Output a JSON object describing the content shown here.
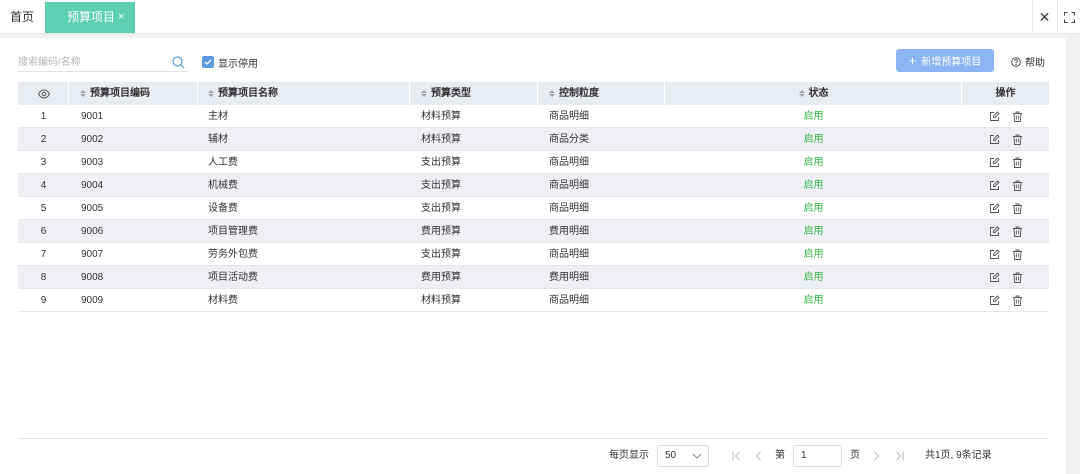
{
  "tabs": {
    "home": "首页",
    "active": "预算项目",
    "active_close": "×"
  },
  "window": {
    "close": "✕"
  },
  "toolbar": {
    "search_placeholder": "搜索编码/名称",
    "search_value": "",
    "show_disabled_label": "显示停用",
    "show_disabled_checked": true,
    "add_button": "新增预算项目",
    "add_icon": "+",
    "help_label": "帮助"
  },
  "colors": {
    "accent_tab": "#5fcfb1",
    "primary_button": "#8ab4f2",
    "status_enabled": "#39b54a",
    "header_bg": "#e8ebf2"
  },
  "table": {
    "columns": {
      "code": "预算项目编码",
      "name": "预算项目名称",
      "type": "预算类型",
      "granularity": "控制粒度",
      "status": "状态",
      "actions": "操作"
    },
    "rows": [
      {
        "idx": "1",
        "code": "9001",
        "name": "主材",
        "type": "材料预算",
        "granularity": "商品明细",
        "status": "启用"
      },
      {
        "idx": "2",
        "code": "9002",
        "name": "辅材",
        "type": "材料预算",
        "granularity": "商品分类",
        "status": "启用"
      },
      {
        "idx": "3",
        "code": "9003",
        "name": "人工费",
        "type": "支出预算",
        "granularity": "商品明细",
        "status": "启用"
      },
      {
        "idx": "4",
        "code": "9004",
        "name": "机械费",
        "type": "支出预算",
        "granularity": "商品明细",
        "status": "启用"
      },
      {
        "idx": "5",
        "code": "9005",
        "name": "设备费",
        "type": "支出预算",
        "granularity": "商品明细",
        "status": "启用"
      },
      {
        "idx": "6",
        "code": "9006",
        "name": "项目管理费",
        "type": "费用预算",
        "granularity": "费用明细",
        "status": "启用"
      },
      {
        "idx": "7",
        "code": "9007",
        "name": "劳务外包费",
        "type": "支出预算",
        "granularity": "商品明细",
        "status": "启用"
      },
      {
        "idx": "8",
        "code": "9008",
        "name": "项目活动费",
        "type": "费用预算",
        "granularity": "费用明细",
        "status": "启用"
      },
      {
        "idx": "9",
        "code": "9009",
        "name": "材料费",
        "type": "材料预算",
        "granularity": "商品明细",
        "status": "启用"
      }
    ],
    "row_icons": [
      "edit-icon",
      "delete-icon"
    ]
  },
  "pagination": {
    "per_page_label": "每页显示",
    "per_page_value": "50",
    "page_prefix": "第",
    "page_value": "1",
    "page_suffix": "页",
    "summary": "共1页, 9条记录"
  }
}
